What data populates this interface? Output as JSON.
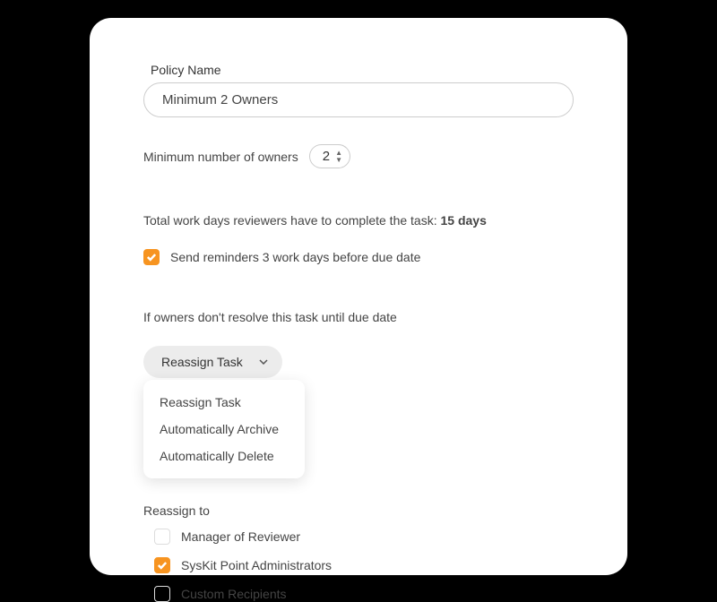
{
  "policy_name": {
    "label": "Policy Name",
    "value": "Minimum 2 Owners"
  },
  "owners": {
    "label": "Minimum number of owners",
    "value": "2"
  },
  "task": {
    "prefix": "Total work days reviewers have to complete the task: ",
    "days": "15 days"
  },
  "reminder": {
    "label": "Send reminders 3 work days before due date",
    "checked": true
  },
  "conditional": {
    "text": "If owners don't resolve this task until due date"
  },
  "action": {
    "selected": "Reassign Task",
    "options": [
      "Reassign Task",
      "Automatically Archive",
      "Automatically Delete"
    ]
  },
  "reassign": {
    "label": "Reassign to",
    "options": [
      {
        "label": "Manager of Reviewer",
        "checked": false
      },
      {
        "label": "SysKit Point Administrators",
        "checked": true
      },
      {
        "label": "Custom Recipients",
        "checked": false
      }
    ]
  }
}
